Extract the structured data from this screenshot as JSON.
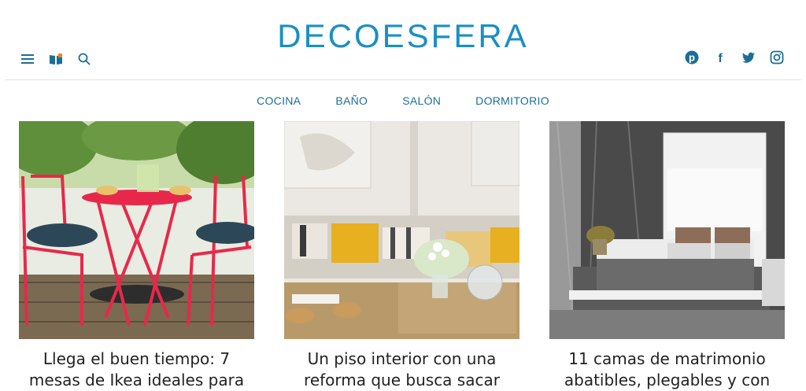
{
  "brand": {
    "name": "DECOESFERA",
    "color": "#1a8fc4"
  },
  "toolbar_left": [
    {
      "icon": "menu-icon"
    },
    {
      "icon": "magazine-icon"
    },
    {
      "icon": "search-icon"
    }
  ],
  "social": [
    {
      "icon": "pinterest-icon"
    },
    {
      "icon": "facebook-icon"
    },
    {
      "icon": "twitter-icon"
    },
    {
      "icon": "instagram-icon"
    }
  ],
  "nav": {
    "items": [
      {
        "label": "COCINA"
      },
      {
        "label": "BAÑO"
      },
      {
        "label": "SALÓN"
      },
      {
        "label": "DORMITORIO"
      }
    ],
    "color": "#1b6e96"
  },
  "articles": [
    {
      "title": "Llega el buen tiempo: 7 mesas de Ikea ideales para"
    },
    {
      "title": "Un piso interior con una reforma que busca sacar"
    },
    {
      "title": "11 camas de matrimonio abatibles, plegables y con"
    }
  ]
}
